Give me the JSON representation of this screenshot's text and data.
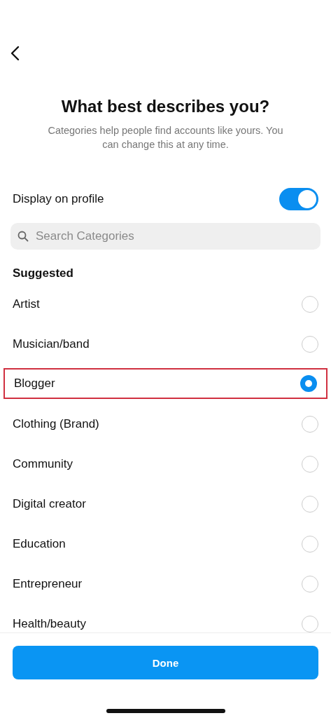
{
  "title": "What best describes you?",
  "subtitle": "Categories help people find accounts like yours. You can change this at any time.",
  "display_toggle": {
    "label": "Display on profile",
    "on": true
  },
  "search": {
    "placeholder": "Search Categories"
  },
  "section_title": "Suggested",
  "categories": [
    {
      "label": "Artist",
      "selected": false,
      "highlighted": false
    },
    {
      "label": "Musician/band",
      "selected": false,
      "highlighted": false
    },
    {
      "label": "Blogger",
      "selected": true,
      "highlighted": true
    },
    {
      "label": "Clothing (Brand)",
      "selected": false,
      "highlighted": false
    },
    {
      "label": "Community",
      "selected": false,
      "highlighted": false
    },
    {
      "label": "Digital creator",
      "selected": false,
      "highlighted": false
    },
    {
      "label": "Education",
      "selected": false,
      "highlighted": false
    },
    {
      "label": "Entrepreneur",
      "selected": false,
      "highlighted": false
    },
    {
      "label": "Health/beauty",
      "selected": false,
      "highlighted": false
    }
  ],
  "done_button": "Done"
}
